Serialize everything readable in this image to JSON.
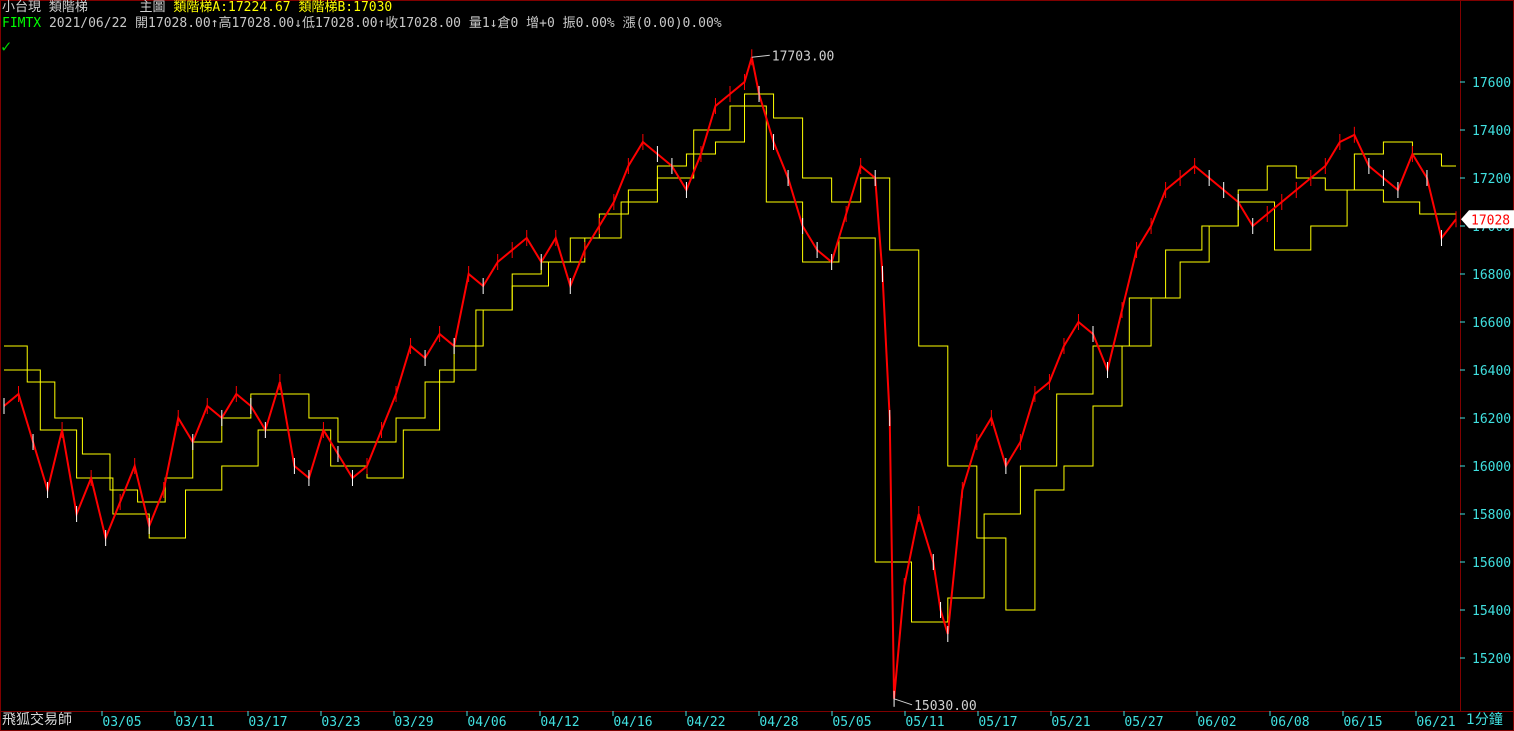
{
  "header": {
    "symbol_name": "小台現",
    "indicator_name": "類階梯",
    "chart_area": "主圖",
    "indicator_a": "類階梯A:17224.67",
    "indicator_b": "類階梯B:17030",
    "quote_line": "2021/06/22 開17028.00↑高17028.00↓低17028.00↑收17028.00 量1↓倉0 增+0 振0.00% 漲(0.00)0.00%",
    "symbol_code": "FIMTX"
  },
  "colors": {
    "background": "#000000",
    "frame": "#800000",
    "price_up": "#ff0000",
    "price_down": "#ffffff",
    "stair": "#ffff00",
    "axis_text": "#40e0e0",
    "last_price_bg": "#ffffff",
    "last_price_text": "#ff0000"
  },
  "footer": {
    "brand": "飛狐交易師",
    "timeframe": "1分鐘"
  },
  "chart_data": {
    "type": "line",
    "title": "",
    "x": [
      "03/05",
      "03/11",
      "03/17",
      "03/23",
      "03/29",
      "04/06",
      "04/12",
      "04/16",
      "04/22",
      "04/28",
      "05/05",
      "05/11",
      "05/17",
      "05/21",
      "05/27",
      "06/02",
      "06/08",
      "06/15",
      "06/21"
    ],
    "ylim": [
      15000,
      17800
    ],
    "yticks": [
      15200,
      15400,
      15600,
      15800,
      16000,
      16200,
      16400,
      16600,
      16800,
      17000,
      17200,
      17400,
      17600
    ],
    "ytick_labels": [
      "15200",
      "15400",
      "15600",
      "15800",
      "16000",
      "16200",
      "16400",
      "16600",
      "16800",
      "17000",
      "17200",
      "17400",
      "17600"
    ],
    "last_price": 17028,
    "last_price_label": "17028",
    "annotations": [
      {
        "label": "17703.00",
        "x": 0.515,
        "y": 17703
      },
      {
        "label": "15030.00",
        "x": 0.613,
        "y": 15030
      }
    ],
    "series": [
      {
        "kind": "price",
        "x": [
          0.0,
          0.01,
          0.02,
          0.03,
          0.04,
          0.05,
          0.06,
          0.07,
          0.08,
          0.09,
          0.1,
          0.11,
          0.12,
          0.13,
          0.14,
          0.15,
          0.16,
          0.17,
          0.18,
          0.19,
          0.2,
          0.21,
          0.22,
          0.23,
          0.24,
          0.25,
          0.26,
          0.27,
          0.28,
          0.29,
          0.3,
          0.31,
          0.32,
          0.33,
          0.34,
          0.35,
          0.36,
          0.37,
          0.38,
          0.39,
          0.4,
          0.41,
          0.42,
          0.43,
          0.44,
          0.45,
          0.46,
          0.47,
          0.48,
          0.49,
          0.5,
          0.51,
          0.515,
          0.52,
          0.53,
          0.54,
          0.55,
          0.56,
          0.57,
          0.58,
          0.59,
          0.6,
          0.605,
          0.61,
          0.613,
          0.62,
          0.63,
          0.64,
          0.645,
          0.65,
          0.66,
          0.67,
          0.68,
          0.69,
          0.7,
          0.71,
          0.72,
          0.73,
          0.74,
          0.75,
          0.76,
          0.77,
          0.78,
          0.79,
          0.8,
          0.81,
          0.82,
          0.83,
          0.84,
          0.85,
          0.86,
          0.87,
          0.88,
          0.89,
          0.9,
          0.91,
          0.92,
          0.93,
          0.94,
          0.95,
          0.96,
          0.97,
          0.98,
          0.99,
          1.0
        ],
        "y": [
          16250,
          16300,
          16100,
          15900,
          16150,
          15800,
          15950,
          15700,
          15850,
          16000,
          15750,
          15900,
          16200,
          16100,
          16250,
          16200,
          16300,
          16250,
          16150,
          16350,
          16000,
          15950,
          16150,
          16050,
          15950,
          16000,
          16150,
          16300,
          16500,
          16450,
          16550,
          16500,
          16800,
          16750,
          16850,
          16900,
          16950,
          16850,
          16950,
          16750,
          16900,
          17000,
          17100,
          17250,
          17350,
          17300,
          17250,
          17150,
          17300,
          17500,
          17550,
          17600,
          17703,
          17550,
          17350,
          17200,
          17000,
          16900,
          16850,
          17050,
          17250,
          17200,
          16800,
          16200,
          15030,
          15500,
          15800,
          15600,
          15400,
          15300,
          15900,
          16100,
          16200,
          16000,
          16100,
          16300,
          16350,
          16500,
          16600,
          16550,
          16400,
          16650,
          16900,
          17000,
          17150,
          17200,
          17250,
          17200,
          17150,
          17100,
          17000,
          17050,
          17100,
          17150,
          17200,
          17250,
          17350,
          17380,
          17250,
          17200,
          17150,
          17300,
          17200,
          16950,
          17028
        ]
      },
      {
        "kind": "stair",
        "x": [
          0.0,
          0.016,
          0.035,
          0.054,
          0.073,
          0.092,
          0.111,
          0.13,
          0.15,
          0.17,
          0.19,
          0.21,
          0.23,
          0.25,
          0.27,
          0.29,
          0.31,
          0.33,
          0.35,
          0.37,
          0.39,
          0.41,
          0.43,
          0.45,
          0.47,
          0.49,
          0.51,
          0.53,
          0.55,
          0.57,
          0.59,
          0.61,
          0.63,
          0.65,
          0.67,
          0.69,
          0.71,
          0.73,
          0.75,
          0.77,
          0.79,
          0.81,
          0.83,
          0.85,
          0.87,
          0.89,
          0.91,
          0.93,
          0.95,
          0.97,
          0.99,
          1.0
        ],
        "y": [
          16500,
          16350,
          16200,
          16050,
          15900,
          15850,
          15950,
          16100,
          16200,
          16300,
          16300,
          16200,
          16100,
          16100,
          16200,
          16350,
          16500,
          16650,
          16800,
          16850,
          16950,
          17050,
          17150,
          17250,
          17300,
          17350,
          17550,
          17450,
          17200,
          17100,
          17200,
          16900,
          16500,
          16000,
          15700,
          15400,
          15900,
          16000,
          16250,
          16500,
          16700,
          16850,
          17000,
          17150,
          17250,
          17200,
          17150,
          17300,
          17350,
          17300,
          17250,
          17250
        ]
      },
      {
        "kind": "stair",
        "x": [
          0.0,
          0.025,
          0.05,
          0.075,
          0.1,
          0.125,
          0.15,
          0.175,
          0.2,
          0.225,
          0.25,
          0.275,
          0.3,
          0.325,
          0.35,
          0.375,
          0.4,
          0.425,
          0.45,
          0.475,
          0.5,
          0.525,
          0.55,
          0.575,
          0.6,
          0.625,
          0.65,
          0.675,
          0.7,
          0.725,
          0.75,
          0.775,
          0.8,
          0.825,
          0.85,
          0.875,
          0.9,
          0.925,
          0.95,
          0.975,
          1.0
        ],
        "y": [
          16400,
          16150,
          15950,
          15800,
          15700,
          15900,
          16000,
          16150,
          16150,
          16000,
          15950,
          16150,
          16400,
          16650,
          16750,
          16850,
          16950,
          17100,
          17200,
          17400,
          17500,
          17100,
          16850,
          16950,
          15600,
          15350,
          15450,
          15800,
          16000,
          16300,
          16500,
          16700,
          16900,
          17000,
          17100,
          16900,
          17000,
          17150,
          17100,
          17050,
          17030
        ]
      }
    ]
  }
}
